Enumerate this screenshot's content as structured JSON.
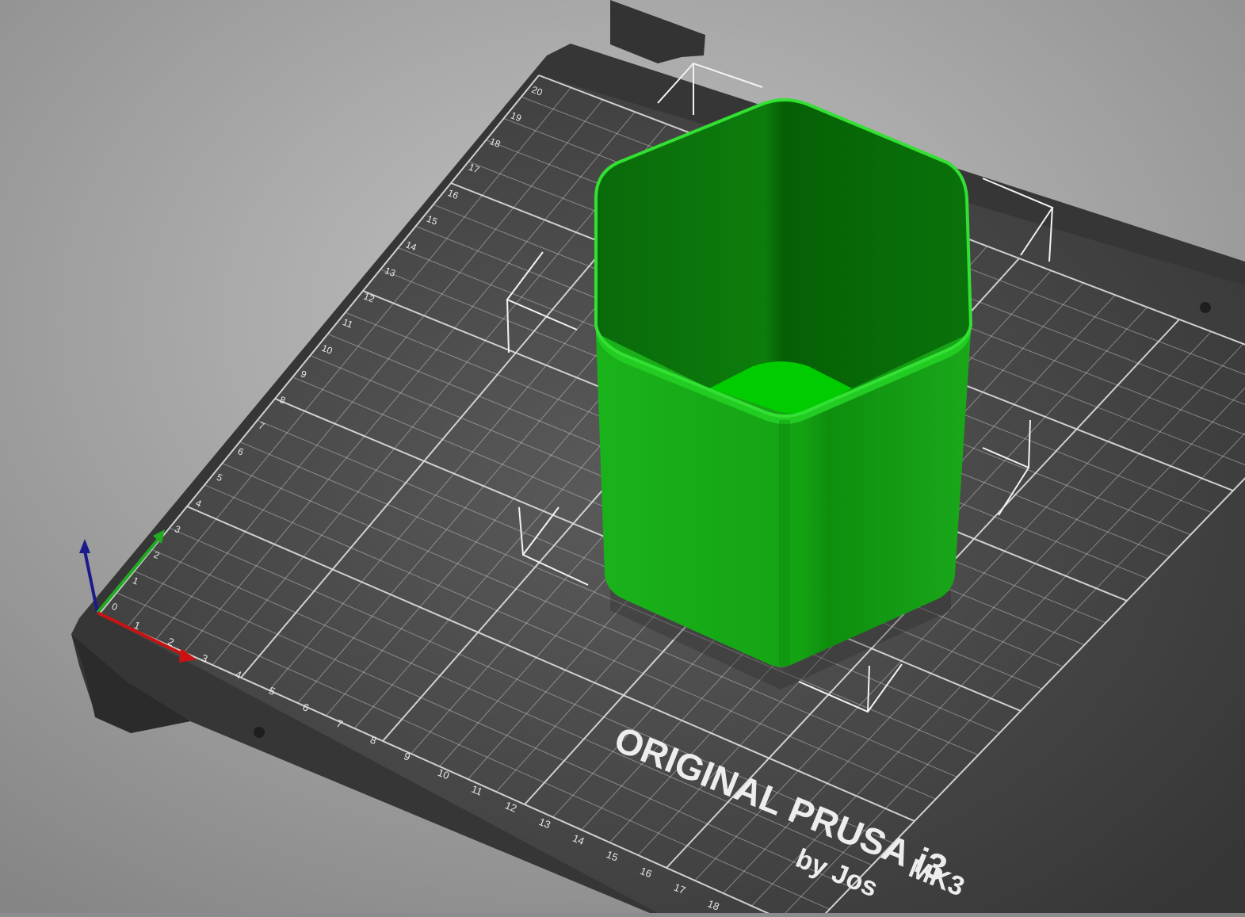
{
  "app": {
    "view": "3D build plate"
  },
  "bed": {
    "logo_line1": "ORIGINAL PRUSA i3",
    "logo_mk": "MK3",
    "logo_by": "by Jos",
    "ruler_y": [
      "0",
      "1",
      "2",
      "3",
      "4",
      "5",
      "6",
      "7",
      "8",
      "9",
      "10",
      "11",
      "12",
      "13",
      "14",
      "15",
      "16",
      "17",
      "18",
      "19",
      "20"
    ],
    "ruler_x": [
      "1",
      "2",
      "3",
      "4",
      "5",
      "6",
      "7",
      "8",
      "9",
      "10",
      "11",
      "12",
      "13",
      "14",
      "15",
      "16",
      "17",
      "18"
    ]
  },
  "model": {
    "name": "hexagonal container",
    "color": "#22c022"
  },
  "colors": {
    "background": "#8c8c8c",
    "bed": "#3a3a3a",
    "grid": "#e6e6e6",
    "model_edge": "#33dd33",
    "axis_x": "#cc1111",
    "axis_y": "#22aa22",
    "axis_z": "#1a1a8c"
  },
  "axes": {
    "x": "X",
    "y": "Y",
    "z": "Z"
  }
}
